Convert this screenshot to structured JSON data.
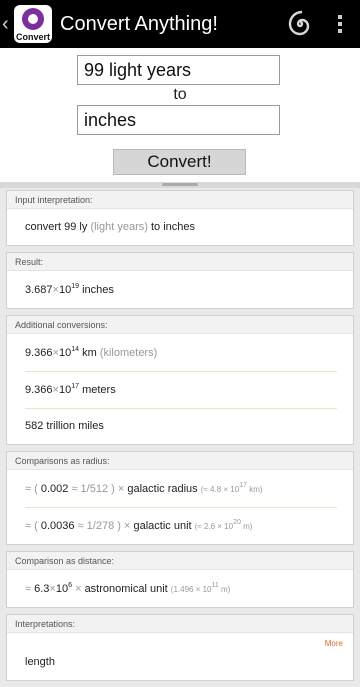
{
  "app": {
    "title": "Convert Anything!",
    "icon_label": "Convert",
    "back": "‹"
  },
  "input": {
    "from_value": "99 light years",
    "to_label": "to",
    "to_value": "inches",
    "convert_label": "Convert!"
  },
  "pods": {
    "input_interp": {
      "title": "Input interpretation:",
      "prefix": "convert 99 ly",
      "paren": "(light years)",
      "suffix": "to inches"
    },
    "result": {
      "title": "Result:",
      "mantissa": "3.687",
      "times": "×",
      "base": "10",
      "exp": "19",
      "unit": "inches"
    },
    "additional": {
      "title": "Additional conversions:",
      "km_mantissa": "9.366",
      "km_base": "10",
      "km_exp": "14",
      "km_unit": "km",
      "km_paren": "(kilometers)",
      "m_mantissa": "9.366",
      "m_base": "10",
      "m_exp": "17",
      "m_unit": "meters",
      "miles": "582 trillion miles"
    },
    "radius": {
      "title": "Comparisons as radius:",
      "r1_approx": "≈",
      "r1_open": "(",
      "r1_value": "0.002",
      "r1_frac": "≈ 1/512",
      "r1_close": ")",
      "r1_times": "×",
      "r1_label": "galactic radius",
      "r1_ref": "(≈ 4.8 × 10",
      "r1_ref_exp": "17",
      "r1_ref_unit": "km)",
      "r2_approx": "≈",
      "r2_open": "(",
      "r2_value": "0.0036",
      "r2_frac": "≈ 1/278",
      "r2_close": ")",
      "r2_times": "×",
      "r2_label": "galactic unit",
      "r2_ref": "(≈ 2.6 × 10",
      "r2_ref_exp": "20",
      "r2_ref_unit": "m)"
    },
    "distance": {
      "title": "Comparison as distance:",
      "approx": "≈",
      "mantissa": "6.3",
      "times": "×",
      "base": "10",
      "exp": "6",
      "times2": "×",
      "label": "astronomical unit",
      "ref": "(1.496 × 10",
      "ref_exp": "11",
      "ref_unit": "m)"
    },
    "interpretations": {
      "title": "Interpretations:",
      "more": "More",
      "item": "length"
    }
  }
}
